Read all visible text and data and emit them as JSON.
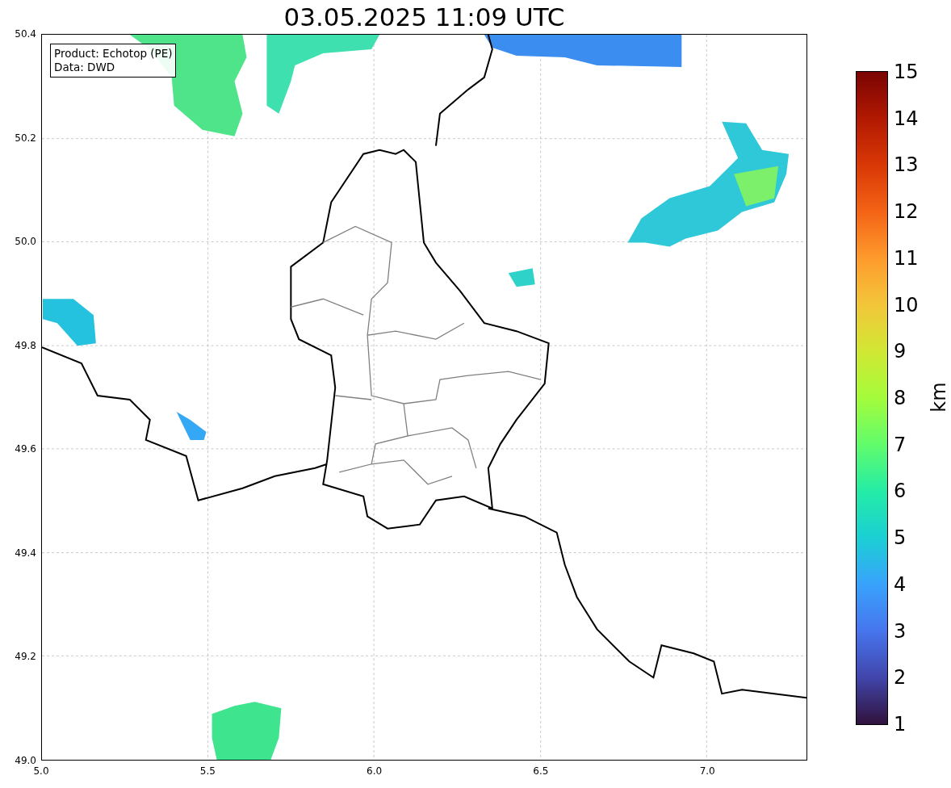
{
  "title": "03.05.2025 11:09 UTC",
  "legend": [
    "Product: Echotop (PE)",
    "Data: DWD"
  ],
  "map": {
    "x_ticks": [
      "5.0",
      "5.5",
      "6.0",
      "6.5",
      "7.0"
    ],
    "y_ticks": [
      "50.4",
      "50.2",
      "50.0",
      "49.8",
      "49.6",
      "49.4",
      "49.2",
      "49.0"
    ]
  },
  "colorbar": {
    "label": "km",
    "ticks": [
      "15",
      "14",
      "13",
      "12",
      "11",
      "10",
      "9",
      "8",
      "7",
      "6",
      "5",
      "4",
      "3",
      "2",
      "1"
    ]
  }
}
